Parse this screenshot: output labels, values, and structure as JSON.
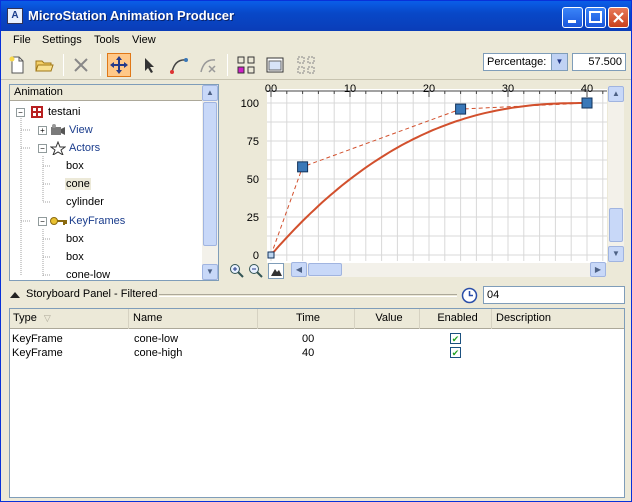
{
  "window": {
    "title": "MicroStation Animation Producer",
    "app_icon_glyph": "A"
  },
  "menu": [
    {
      "label": "File"
    },
    {
      "label": "Settings"
    },
    {
      "label": "Tools"
    },
    {
      "label": "View"
    }
  ],
  "toolbar": {
    "percentage_select": "Percentage:",
    "percentage_value": "57.500"
  },
  "tree": {
    "header": "Animation",
    "root": "testani",
    "view": "View",
    "actors": "Actors",
    "actor_items": [
      "box",
      "cone",
      "cylinder"
    ],
    "keyframes": "KeyFrames",
    "keyframe_items": [
      "box",
      "box",
      "cone-low"
    ]
  },
  "graph": {
    "x_ticks": [
      "00",
      "10",
      "20",
      "30",
      "40"
    ],
    "y_ticks": [
      "100",
      "75",
      "50",
      "25",
      "0"
    ],
    "keyframes": [
      {
        "x": 0,
        "y": 0
      },
      {
        "x": 4,
        "y": 58
      },
      {
        "x": 24,
        "y": 96
      },
      {
        "x": 40,
        "y": 100
      }
    ],
    "curve_color": "#d2502d",
    "key_color": "#3a78b8"
  },
  "storyboard": {
    "title": "Storyboard Panel - Filtered",
    "time_value": "04"
  },
  "table": {
    "columns": [
      "Type",
      "Name",
      "Time",
      "Value",
      "Enabled",
      "Description"
    ],
    "rows": [
      {
        "type": "KeyFrame",
        "name": "cone-low",
        "time": "00",
        "value": "",
        "enabled": true,
        "description": ""
      },
      {
        "type": "KeyFrame",
        "name": "cone-high",
        "time": "40",
        "value": "",
        "enabled": true,
        "description": ""
      }
    ]
  }
}
